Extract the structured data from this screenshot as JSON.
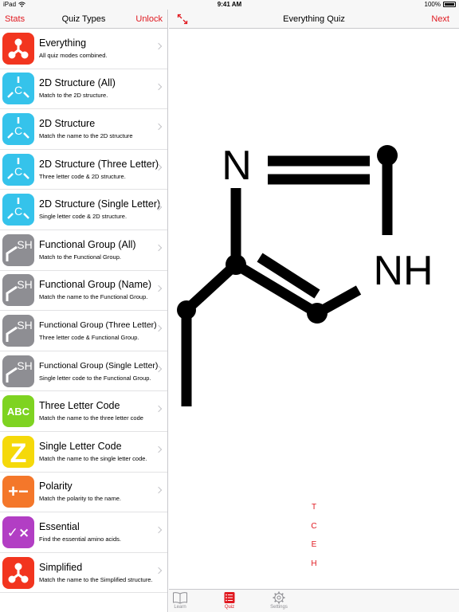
{
  "status_bar": {
    "device": "iPad",
    "time": "9:41 AM",
    "battery": "100%"
  },
  "sidebar": {
    "left_button": "Stats",
    "title": "Quiz Types",
    "right_button": "Unlock",
    "items": [
      {
        "title": "Everything",
        "subtitle": "All quiz modes combined.",
        "icon": "everything-icon",
        "color": "#f2351f"
      },
      {
        "title": "2D Structure (All)",
        "subtitle": "Match to the 2D structure.",
        "icon": "2d-structure-icon",
        "color": "#35c3eb"
      },
      {
        "title": "2D Structure",
        "subtitle": "Match the name to the 2D structure",
        "icon": "2d-structure-icon",
        "color": "#35c3eb"
      },
      {
        "title": "2D Structure (Three Letter)",
        "subtitle": "Three letter code & 2D structure.",
        "icon": "2d-structure-icon",
        "color": "#35c3eb"
      },
      {
        "title": "2D Structure (Single Letter)",
        "subtitle": "Single letter code & 2D structure.",
        "icon": "2d-structure-icon",
        "color": "#35c3eb"
      },
      {
        "title": "Functional Group (All)",
        "subtitle": "Match to the Functional Group.",
        "icon": "functional-group-icon",
        "color": "#8e8e93"
      },
      {
        "title": "Functional Group (Name)",
        "subtitle": "Match the name to the Functional Group.",
        "icon": "functional-group-icon",
        "color": "#8e8e93"
      },
      {
        "title": "Functional Group (Three Letter)",
        "subtitle": "Three letter code & Functional Group.",
        "icon": "functional-group-icon",
        "color": "#8e8e93"
      },
      {
        "title": "Functional Group (Single Letter)",
        "subtitle": "Single letter code to the Functional Group.",
        "icon": "functional-group-icon",
        "color": "#8e8e93"
      },
      {
        "title": "Three Letter Code",
        "subtitle": "Match the name to the three letter code",
        "icon": "abc-icon",
        "color": "#7ed321"
      },
      {
        "title": "Single Letter Code",
        "subtitle": "Match the name to the single letter code.",
        "icon": "z-letter-icon",
        "color": "#f5d90a"
      },
      {
        "title": "Polarity",
        "subtitle": "Match the polarity to the name.",
        "icon": "plus-minus-icon",
        "color": "#f4772a"
      },
      {
        "title": "Essential",
        "subtitle": "Find the essential amino acids.",
        "icon": "check-cross-icon",
        "color": "#b23ec4"
      },
      {
        "title": "Simplified",
        "subtitle": "Match the name to the Simplified structure.",
        "icon": "everything-icon",
        "color": "#f2351f"
      }
    ],
    "icon_text": {
      "c": "C",
      "sh": "SH",
      "abc": "ABC",
      "z": "Z",
      "pm": "+−",
      "cx": "✓×"
    }
  },
  "main": {
    "title": "Everything Quiz",
    "right_button": "Next",
    "molecule": {
      "atom_n": "N",
      "atom_nh": "NH"
    },
    "answer_letters": [
      "T",
      "C",
      "E",
      "H"
    ]
  },
  "tabbar": {
    "tabs": [
      {
        "label": "Learn",
        "icon": "book-icon",
        "active": false
      },
      {
        "label": "Quiz",
        "icon": "list-icon",
        "active": true
      },
      {
        "label": "Settings",
        "icon": "gear-icon",
        "active": false
      }
    ]
  },
  "colors": {
    "accent": "#e0181f"
  }
}
